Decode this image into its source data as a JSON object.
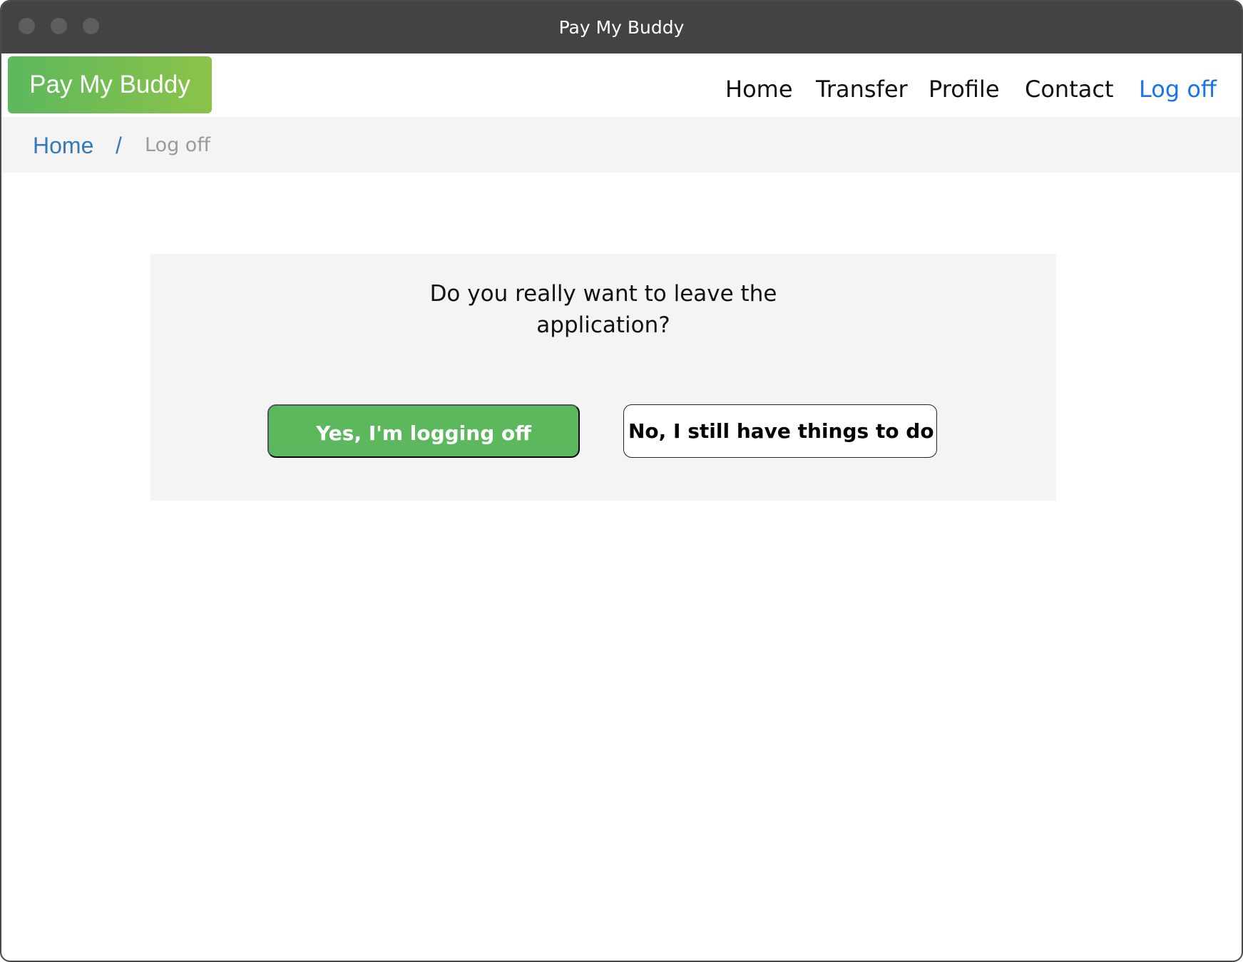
{
  "window": {
    "title": "Pay My Buddy"
  },
  "navbar": {
    "brand": "Pay My Buddy",
    "links": [
      {
        "label": "Home",
        "active": false
      },
      {
        "label": "Transfer",
        "active": false
      },
      {
        "label": "Profile",
        "active": false
      },
      {
        "label": "Contact",
        "active": false
      },
      {
        "label": "Log off",
        "active": true
      }
    ]
  },
  "breadcrumb": {
    "home": "Home",
    "separator": "/",
    "current": "Log off"
  },
  "dialog": {
    "question": "Do you really want to leave the application?",
    "confirm_label": "Yes, I'm logging off",
    "cancel_label": "No, I still have things to do"
  },
  "colors": {
    "brand_green": "#5cb85c",
    "link_blue": "#1a73e8",
    "breadcrumb_blue": "#337ab7"
  }
}
